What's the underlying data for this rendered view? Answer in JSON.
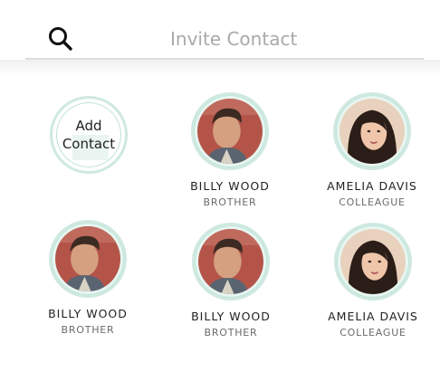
{
  "search": {
    "placeholder": "Invite Contact",
    "icon": "search-icon"
  },
  "add_contact": {
    "line1": "Add",
    "line2": "Contact"
  },
  "contacts": [
    {
      "name": "BILLY WOOD",
      "relation": "BROTHER",
      "avatar": "male"
    },
    {
      "name": "AMELIA DAVIS",
      "relation": "COLLEAGUE",
      "avatar": "female"
    },
    {
      "name": "BILLY WOOD",
      "relation": "BROTHER",
      "avatar": "male"
    },
    {
      "name": "BILLY WOOD",
      "relation": "BROTHER",
      "avatar": "male"
    },
    {
      "name": "AMELIA DAVIS",
      "relation": "COLLEAGUE",
      "avatar": "female"
    }
  ],
  "colors": {
    "ring": "#cfe9e1",
    "text": "#222222",
    "subtext": "#6b6b6b",
    "placeholder": "#a9a9a9"
  }
}
